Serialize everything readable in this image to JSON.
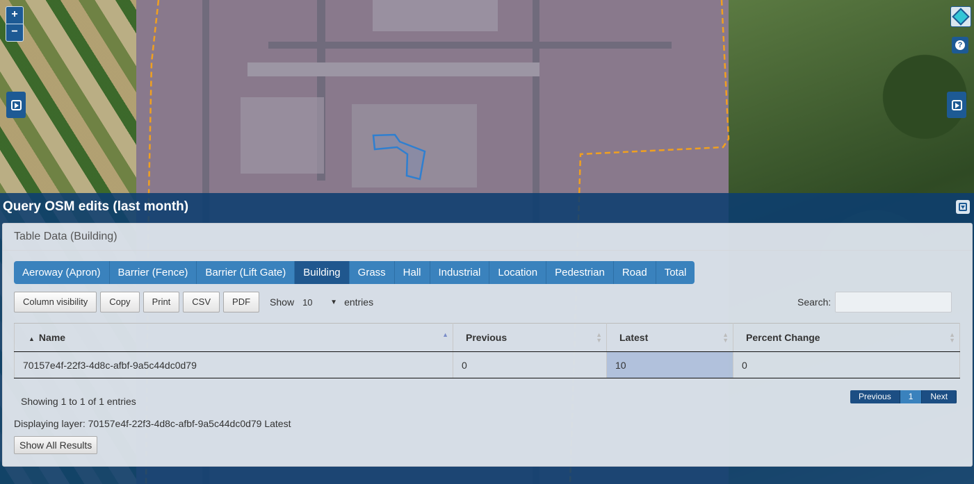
{
  "map": {
    "controls": {
      "zoom_in": "+",
      "zoom_out": "−",
      "layers_icon": "layers-icon",
      "help_icon": "?",
      "expand_icon": "expand-icon"
    },
    "colors": {
      "boundary": "#f0a020",
      "selection": "#2f7fd0",
      "ui_blue": "#1d5a94"
    }
  },
  "panel": {
    "title": "Query OSM edits (last month)",
    "card_title": "Table Data (Building)",
    "tabs": [
      {
        "label": "Aeroway (Apron)",
        "active": false
      },
      {
        "label": "Barrier (Fence)",
        "active": false
      },
      {
        "label": "Barrier (Lift Gate)",
        "active": false
      },
      {
        "label": "Building",
        "active": true
      },
      {
        "label": "Grass",
        "active": false
      },
      {
        "label": "Hall",
        "active": false
      },
      {
        "label": "Industrial",
        "active": false
      },
      {
        "label": "Location",
        "active": false
      },
      {
        "label": "Pedestrian",
        "active": false
      },
      {
        "label": "Road",
        "active": false
      },
      {
        "label": "Total",
        "active": false
      }
    ],
    "toolbar": {
      "buttons": [
        "Column visibility",
        "Copy",
        "Print",
        "CSV",
        "PDF"
      ],
      "show_label": "Show",
      "entries_value": "10",
      "entries_label": "entries",
      "search_label": "Search:",
      "search_value": ""
    },
    "table": {
      "columns": [
        "Name",
        "Previous",
        "Latest",
        "Percent Change"
      ],
      "sorted_column": "Name",
      "rows": [
        [
          "70157e4f-22f3-4d8c-afbf-9a5c44dc0d79",
          "0",
          "10",
          "0"
        ]
      ]
    },
    "info": "Showing 1 to 1 of 1 entries",
    "pagination": {
      "previous": "Previous",
      "current": "1",
      "next": "Next"
    },
    "displaying": "Displaying layer: 70157e4f-22f3-4d8c-afbf-9a5c44dc0d79 Latest",
    "show_all": "Show All Results"
  }
}
